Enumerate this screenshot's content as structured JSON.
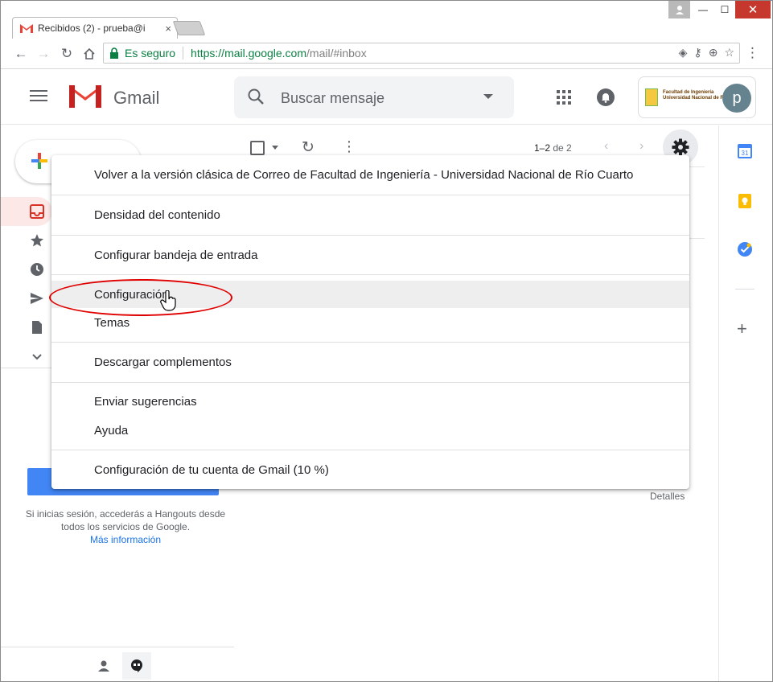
{
  "browser": {
    "tab_title": "Recibidos (2) - prueba@i",
    "tab_close": "×",
    "window_controls": {
      "minimize": "—",
      "maximize": "☐",
      "close": "✕"
    },
    "secure_label": "Es seguro",
    "url_host": "https://mail.google.com",
    "url_rest": "/mail/#inbox"
  },
  "gmail": {
    "product_name": "Gmail",
    "search_placeholder": "Buscar mensaje",
    "account_initial": "p",
    "org_name_line1": "Facultad de Ingeniería",
    "org_name_line2": "Universidad Nacional de Río Cuarto"
  },
  "toolbar": {
    "pager_range": "1–2",
    "pager_rest": " de 2"
  },
  "menu": {
    "items": [
      "Volver a la versión clásica de Correo de Facultad de Ingeniería - Universidad Nacional de Río Cuarto",
      "Densidad del contenido",
      "Configurar bandeja de entrada",
      "Configuración",
      "Temas",
      "Descargar complementos",
      "Enviar sugerencias",
      "Ayuda",
      "Configuración de tu cuenta de Gmail (10 %)"
    ]
  },
  "main": {
    "details_link": "Detalles"
  },
  "hangouts": {
    "message": "Si inicias sesión, accederás a Hangouts desde todos los servicios de Google.",
    "link": "Más información"
  },
  "side_panel": {
    "calendar_day": "31"
  },
  "colors": {
    "accent": "#4285f4",
    "gmail_red": "#ea4335",
    "secure_green": "#0b8043",
    "annotation_red": "#e00000"
  }
}
